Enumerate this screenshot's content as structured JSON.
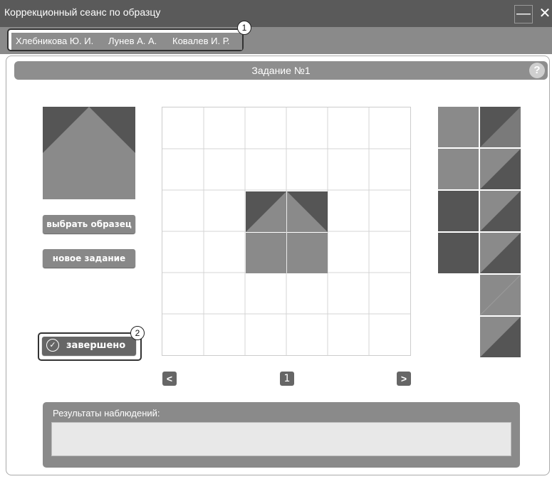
{
  "window": {
    "title": "Коррекционный сеанс по образцу",
    "minimize_glyph": "—",
    "close_glyph": "✕"
  },
  "tabs": [
    {
      "label": "Хлебникова Ю. И."
    },
    {
      "label": "Лунев А. А."
    },
    {
      "label": "Ковалев И. Р."
    }
  ],
  "callouts": {
    "tabs": "1",
    "done": "2"
  },
  "task": {
    "title": "Задание №1",
    "help": "?"
  },
  "buttons": {
    "pick_sample": "выбрать образец",
    "new_task": "новое задание",
    "done": "завершено",
    "done_icon": "check-circle-icon"
  },
  "pager": {
    "prev": "<",
    "page": "1",
    "next": ">"
  },
  "results": {
    "label": "Результаты наблюдений:",
    "value": ""
  },
  "colors": {
    "dark": "#555555",
    "light": "#8a8a8a",
    "header": "#8e8e8e",
    "titlebar": "#5a5a5a"
  }
}
